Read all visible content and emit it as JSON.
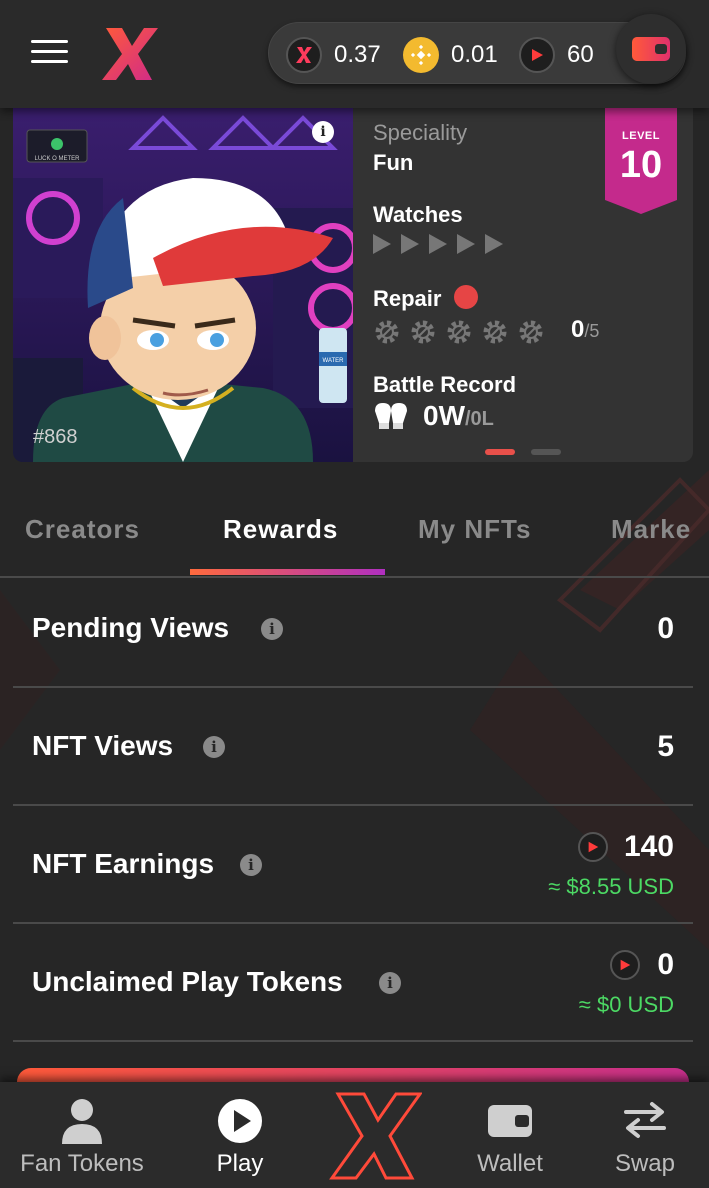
{
  "header": {
    "balances": [
      {
        "icon": "x-token-icon",
        "value": "0.37"
      },
      {
        "icon": "bnb-coin-icon",
        "value": "0.01"
      },
      {
        "icon": "play-token-icon",
        "value": "60"
      }
    ]
  },
  "nft_card": {
    "id": "#868",
    "speciality_label": "Speciality",
    "speciality_value": "Fun",
    "watches_label": "Watches",
    "watches_filled": 0,
    "watches_total": 5,
    "repair_label": "Repair",
    "repair_count": "0",
    "repair_total": "/5",
    "battle_label": "Battle Record",
    "battle_wins": "0W",
    "battle_losses": "/0L",
    "level_label": "LEVEL",
    "level_value": "10",
    "pager_active": 0,
    "pager_total": 2,
    "artwork_sign": "LUCK O METER",
    "bottle_label": "WATER"
  },
  "tabs": [
    {
      "label": "Creators",
      "active": false
    },
    {
      "label": "Rewards",
      "active": true
    },
    {
      "label": "My NFTs",
      "active": false
    },
    {
      "label": "Marke",
      "active": false
    }
  ],
  "rewards": [
    {
      "label": "Pending Views",
      "value": "0"
    },
    {
      "label": "NFT Views",
      "value": "5"
    },
    {
      "label": "NFT Earnings",
      "value": "140",
      "usd": "≈ $8.55 USD"
    },
    {
      "label": "Unclaimed Play Tokens",
      "value": "0",
      "usd": "≈ $0 USD"
    }
  ],
  "bottom_nav": [
    {
      "label": "Fan Tokens",
      "icon": "user-icon",
      "active": false
    },
    {
      "label": "Play",
      "icon": "play-icon",
      "active": true
    },
    {
      "label": "",
      "icon": "x-logo-icon",
      "active": false
    },
    {
      "label": "Wallet",
      "icon": "wallet-icon",
      "active": false
    },
    {
      "label": "Swap",
      "icon": "swap-icon",
      "active": false
    }
  ],
  "colors": {
    "accent_gradient_start": "#ff6a3d",
    "accent_gradient_end": "#b02fc0",
    "usd_green": "#4cd964",
    "level_badge": "#c42a8c",
    "background": "#262626"
  }
}
